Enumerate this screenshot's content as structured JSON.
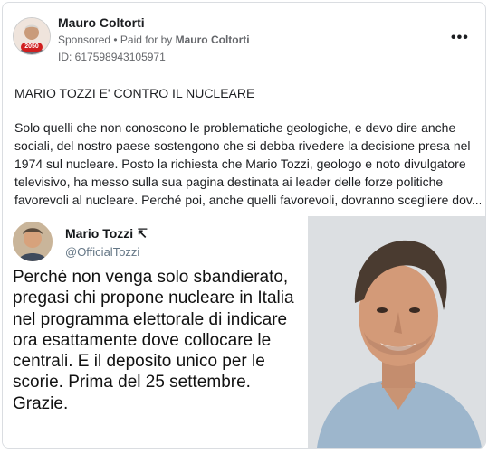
{
  "post": {
    "author": "Mauro Coltorti",
    "sponsored": "Sponsored",
    "paid_prefix": "• Paid for by",
    "paid_by": "Mauro Coltorti",
    "ad_id": "ID: 617598943105971",
    "more_label": "•••",
    "avatar_badge": "2050",
    "headline": "MARIO TOZZI E' CONTRO IL NUCLEARE",
    "body_lines": [
      "Solo quelli che non conoscono le problematiche geologiche, e devo dire anche",
      "sociali, del nostro paese sostengono che si debba rivedere la decisione presa nel",
      "1974 sul nucleare. Posto la richiesta che Mario Tozzi, geologo e noto divulgatore",
      "televisivo, ha messo sulla sua pagina destinata ai leader delle forze politiche",
      "favorevoli al nucleare. Perché poi, anche quelli favorevoli, dovranno scegliere dov..."
    ]
  },
  "tweet": {
    "name": "Mario Tozzi",
    "name_mark": "↸",
    "handle": "@OfficialTozzi",
    "text_lines": [
      "Perché non venga solo sbandierato,",
      "pregasi chi propone nucleare in Italia",
      "nel programma elettorale di indicare",
      "ora esattamente dove collocare le",
      "centrali. E il deposito unico per le",
      "scorie. Prima del 25 settembre.",
      "Grazie."
    ]
  }
}
